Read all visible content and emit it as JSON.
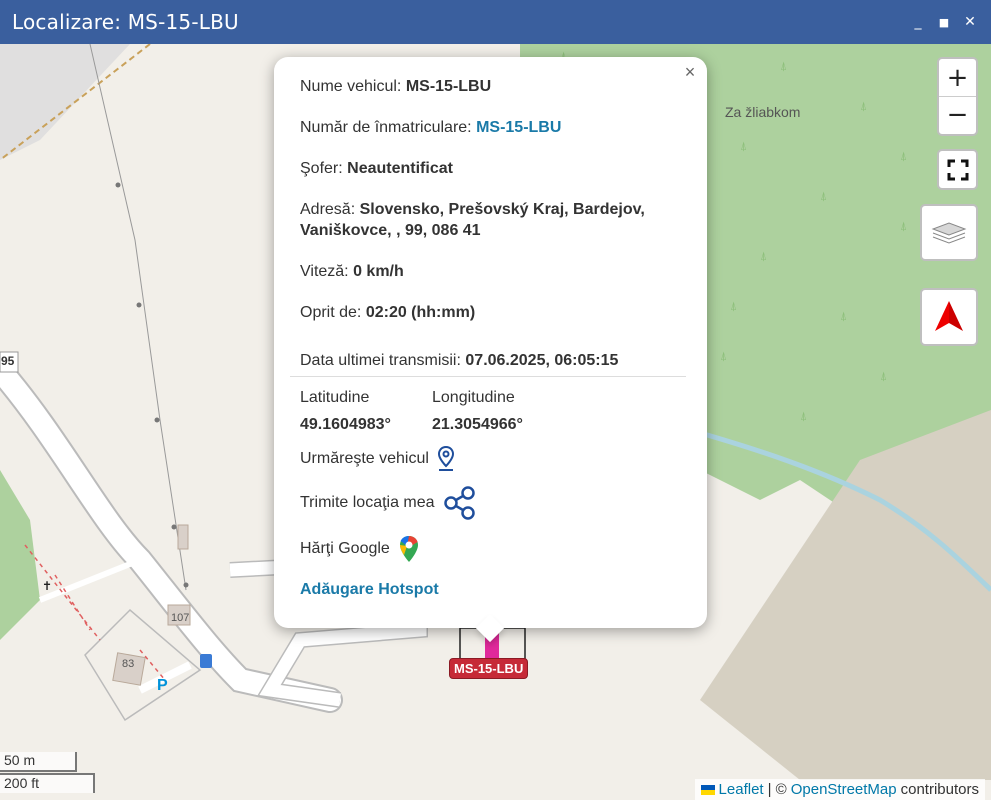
{
  "window": {
    "title": "Localizare: MS-15-LBU",
    "buttons": {
      "minimize": "_",
      "maximize": "■",
      "close": "✕"
    }
  },
  "map": {
    "zoom_in": "+",
    "zoom_out": "−",
    "place_label": "Za žliabkom",
    "road_ref": "95",
    "house_numbers": [
      "107",
      "83"
    ],
    "parking": "P",
    "scale_metric": "50 m",
    "scale_imperial": "200 ft",
    "attribution": {
      "leaflet": "Leaflet",
      "separator": "| ©",
      "osm": "OpenStreetMap",
      "contributors": "contributors"
    },
    "vehicle_marker_label": "MS-15-LBU"
  },
  "popup": {
    "vehicle_name_label": "Nume vehicul:",
    "vehicle_name": "MS-15-LBU",
    "registration_label": "Număr de înmatriculare:",
    "registration": "MS-15-LBU",
    "driver_label": "Şofer:",
    "driver": "Neautentificat",
    "address_label": "Adresă:",
    "address": "Slovensko, Prešovský Kraj, Bardejov, Vaniškovce, , 99, 086 41",
    "speed_label": "Viteză:",
    "speed": "0 km/h",
    "stopped_label": "Oprit de:",
    "stopped": "02:20 (hh:mm)",
    "last_tx_label": "Data ultimei transmisii:",
    "last_tx": "07.06.2025, 06:05:15",
    "lat_label": "Latitudine",
    "lat": "49.1604983°",
    "lon_label": "Longitudine",
    "lon": "21.3054966°",
    "follow_label": "Urmăreşte vehicul",
    "share_label": "Trimite locaţia mea",
    "google_label": "Hărţi Google",
    "hotspot_label": "Adăugare Hotspot",
    "close": "×"
  },
  "colors": {
    "titlebar": "#3a5f9e",
    "link": "#1a7aa8",
    "forest": "#add19e",
    "marker": "#c62a37"
  }
}
